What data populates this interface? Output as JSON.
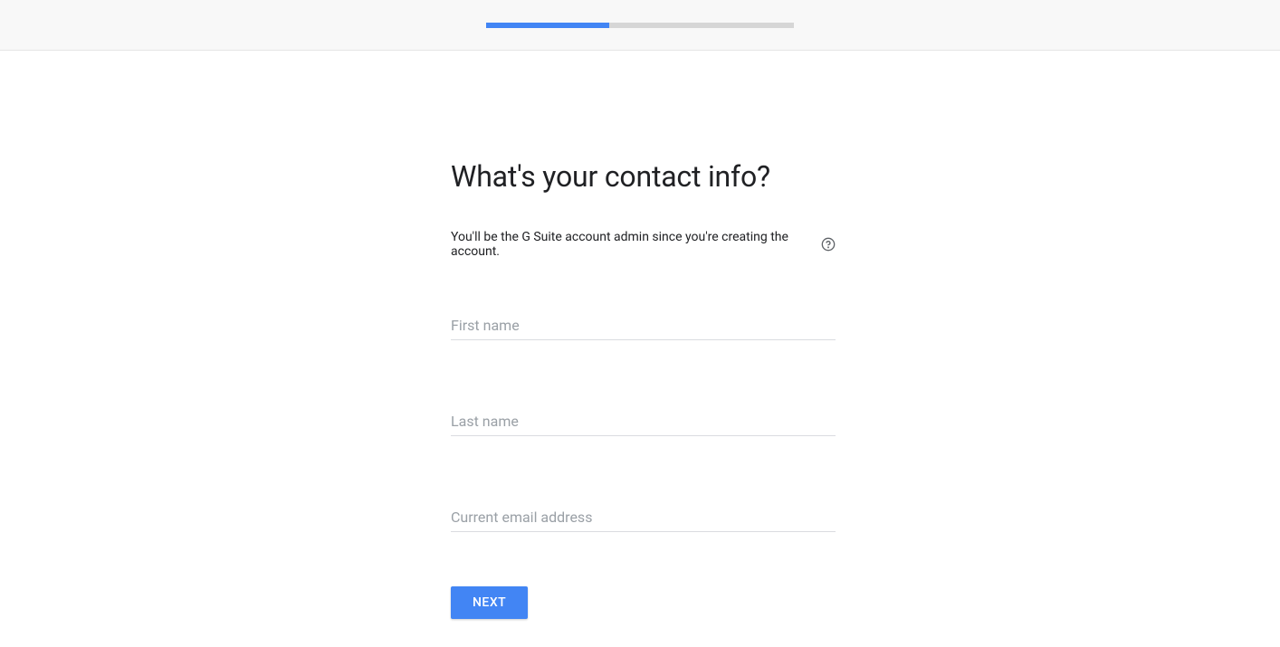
{
  "progress": {
    "percent": 40
  },
  "heading": "What's your contact info?",
  "subtext": "You'll be the G Suite account admin since you're creating the account.",
  "fields": {
    "first_name": {
      "placeholder": "First name",
      "value": ""
    },
    "last_name": {
      "placeholder": "Last name",
      "value": ""
    },
    "email": {
      "placeholder": "Current email address",
      "value": ""
    }
  },
  "buttons": {
    "next": "NEXT"
  },
  "icons": {
    "help": "help-circle"
  }
}
